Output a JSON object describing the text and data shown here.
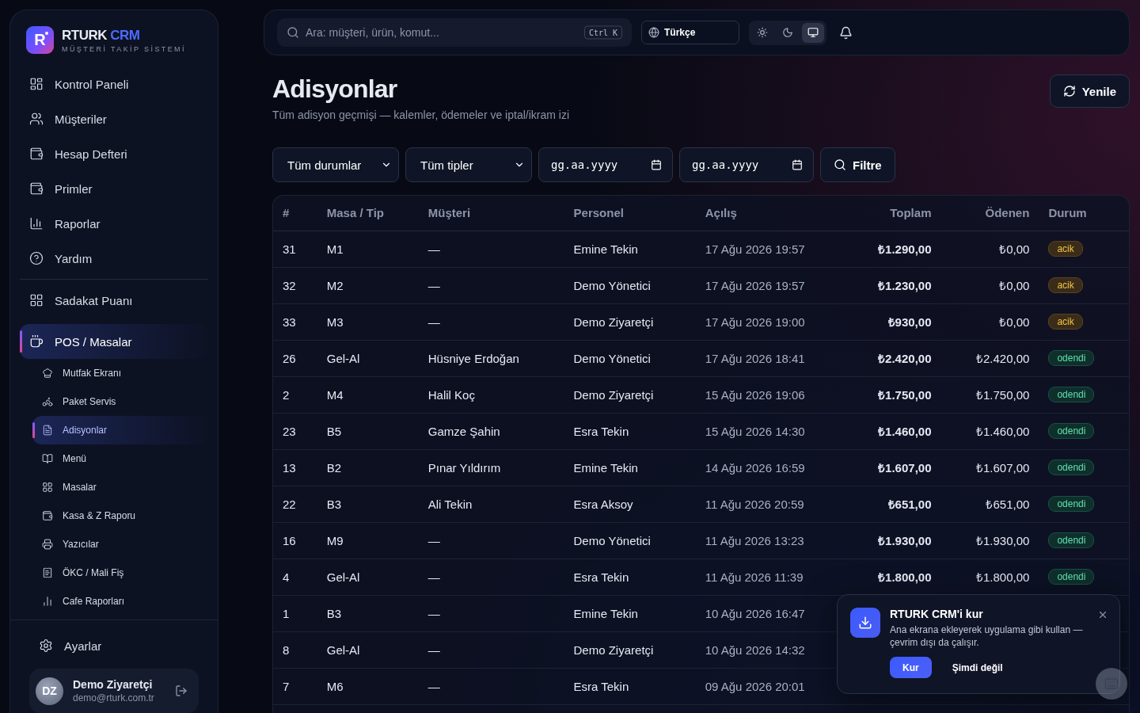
{
  "brand": {
    "logo_letter": "R",
    "name": "RTURK",
    "accent": "CRM",
    "tagline": "MÜŞTERİ TAKİP SİSTEMİ"
  },
  "nav_main": [
    {
      "label": "Kontrol Paneli",
      "selected": false
    },
    {
      "label": "Müşteriler",
      "selected": false
    },
    {
      "label": "Hesap Defteri",
      "selected": false
    },
    {
      "label": "Primler",
      "selected": false
    },
    {
      "label": "Raporlar",
      "selected": false
    },
    {
      "label": "Yardım",
      "selected": false
    }
  ],
  "nav_extra": [
    {
      "label": "Sadakat Puanı",
      "selected": false
    },
    {
      "label": "POS / Masalar",
      "selected": true,
      "children": [
        {
          "label": "Mutfak Ekranı",
          "selected": false
        },
        {
          "label": "Paket Servis",
          "selected": false
        },
        {
          "label": "Adisyonlar",
          "selected": true
        },
        {
          "label": "Menü",
          "selected": false
        },
        {
          "label": "Masalar",
          "selected": false
        },
        {
          "label": "Kasa & Z Raporu",
          "selected": false
        },
        {
          "label": "Yazıcılar",
          "selected": false
        },
        {
          "label": "ÖKC / Mali Fiş",
          "selected": false
        },
        {
          "label": "Cafe Raporları",
          "selected": false
        }
      ]
    }
  ],
  "settings": {
    "label": "Ayarlar"
  },
  "user": {
    "initials": "DZ",
    "name": "Demo Ziyaretçi",
    "email": "demo@rturk.com.tr"
  },
  "topbar": {
    "search_placeholder": "Ara: müşteri, ürün, komut...",
    "shortcut": "Ctrl K",
    "language": "Türkçe",
    "theme_modes": [
      {
        "selected": false
      },
      {
        "selected": false
      },
      {
        "selected": true
      }
    ]
  },
  "page": {
    "title": "Adisyonlar",
    "subtitle": "Tüm adisyon geçmişi — kalemler, ödemeler ve iptal/ikram izi",
    "refresh": "Yenile"
  },
  "filters": {
    "status": "Tüm durumlar",
    "type": "Tüm tipler",
    "date_from_placeholder": "gg.aa.yyyy",
    "date_to_placeholder": "gg.aa.yyyy",
    "button": "Filtre"
  },
  "table": {
    "columns": [
      "#",
      "Masa / Tip",
      "Müşteri",
      "Personel",
      "Açılış",
      "Toplam",
      "Ödenen",
      "Durum"
    ],
    "rows": [
      {
        "id": "31",
        "table": "M1",
        "customer": "—",
        "staff": "Emine Tekin",
        "opened": "17 Ağu 2026 19:57",
        "total": "₺1.290,00",
        "paid": "₺0,00",
        "status": "acik",
        "kind": "open"
      },
      {
        "id": "32",
        "table": "M2",
        "customer": "—",
        "staff": "Demo Yönetici",
        "opened": "17 Ağu 2026 19:57",
        "total": "₺1.230,00",
        "paid": "₺0,00",
        "status": "acik",
        "kind": "open"
      },
      {
        "id": "33",
        "table": "M3",
        "customer": "—",
        "staff": "Demo Ziyaretçi",
        "opened": "17 Ağu 2026 19:00",
        "total": "₺930,00",
        "paid": "₺0,00",
        "status": "acik",
        "kind": "open"
      },
      {
        "id": "26",
        "table": "Gel-Al",
        "customer": "Hüsniye Erdoğan",
        "staff": "Demo Yönetici",
        "opened": "17 Ağu 2026 18:41",
        "total": "₺2.420,00",
        "paid": "₺2.420,00",
        "status": "odendi",
        "kind": "paid"
      },
      {
        "id": "2",
        "table": "M4",
        "customer": "Halil Koç",
        "staff": "Demo Ziyaretçi",
        "opened": "15 Ağu 2026 19:06",
        "total": "₺1.750,00",
        "paid": "₺1.750,00",
        "status": "odendi",
        "kind": "paid"
      },
      {
        "id": "23",
        "table": "B5",
        "customer": "Gamze Şahin",
        "staff": "Esra Tekin",
        "opened": "15 Ağu 2026 14:30",
        "total": "₺1.460,00",
        "paid": "₺1.460,00",
        "status": "odendi",
        "kind": "paid"
      },
      {
        "id": "13",
        "table": "B2",
        "customer": "Pınar Yıldırım",
        "staff": "Emine Tekin",
        "opened": "14 Ağu 2026 16:59",
        "total": "₺1.607,00",
        "paid": "₺1.607,00",
        "status": "odendi",
        "kind": "paid"
      },
      {
        "id": "22",
        "table": "B3",
        "customer": "Ali Tekin",
        "staff": "Esra Aksoy",
        "opened": "11 Ağu 2026 20:59",
        "total": "₺651,00",
        "paid": "₺651,00",
        "status": "odendi",
        "kind": "paid"
      },
      {
        "id": "16",
        "table": "M9",
        "customer": "—",
        "staff": "Demo Yönetici",
        "opened": "11 Ağu 2026 13:23",
        "total": "₺1.930,00",
        "paid": "₺1.930,00",
        "status": "odendi",
        "kind": "paid"
      },
      {
        "id": "4",
        "table": "Gel-Al",
        "customer": "—",
        "staff": "Esra Tekin",
        "opened": "11 Ağu 2026 11:39",
        "total": "₺1.800,00",
        "paid": "₺1.800,00",
        "status": "odendi",
        "kind": "paid"
      },
      {
        "id": "1",
        "table": "B3",
        "customer": "—",
        "staff": "Emine Tekin",
        "opened": "10 Ağu 2026 16:47"
      },
      {
        "id": "8",
        "table": "Gel-Al",
        "customer": "—",
        "staff": "Demo Ziyaretçi",
        "opened": "10 Ağu 2026 14:32"
      },
      {
        "id": "7",
        "table": "M6",
        "customer": "—",
        "staff": "Esra Tekin",
        "opened": "09 Ağu 2026 20:01"
      }
    ]
  },
  "install_prompt": {
    "title": "RTURK CRM'i kur",
    "message": "Ana ekrana ekleyerek uygulama gibi kullan — çevrim dışı da çalışır.",
    "install": "Kur",
    "dismiss": "Şimdi değil"
  }
}
